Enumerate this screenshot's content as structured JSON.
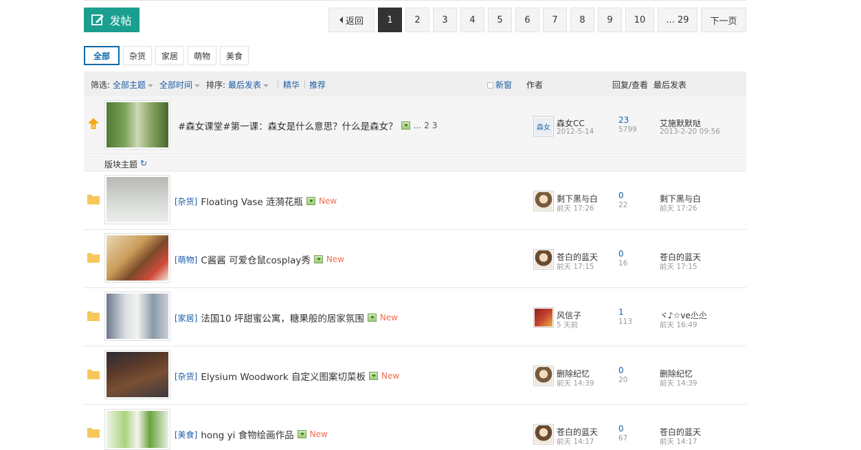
{
  "toolbar": {
    "post_label": "发帖"
  },
  "pagination": {
    "back_label": "返回",
    "pages": [
      "1",
      "2",
      "3",
      "4",
      "5",
      "6",
      "7",
      "8",
      "9",
      "10"
    ],
    "last_label": "... 29",
    "next_label": "下一页",
    "current": "1"
  },
  "category_tabs": [
    "全部",
    "杂货",
    "家居",
    "萌物",
    "美食"
  ],
  "filter": {
    "filter_label": "筛选:",
    "all_topics": "全部主题",
    "all_time": "全部时间",
    "sort_label": "排序:",
    "last_post": "最后发表",
    "digest": "精华",
    "recommend": "推荐",
    "new_window": "新窗",
    "col_author": "作者",
    "col_reply_view": "回复/查看",
    "col_last_post": "最后发表"
  },
  "sticky": {
    "title": "#森女课堂#第一课：森女是什么意思？什么是森女？",
    "pages_prefix": "...",
    "pages": [
      "2",
      "3"
    ],
    "author": "森女CC",
    "author_date": "2012-5-14",
    "replies": "23",
    "views": "5799",
    "last_user": "艾施默默哒",
    "last_date": "2013-2-20 09:56"
  },
  "section": {
    "title": "版块主题"
  },
  "new_label": "New",
  "threads": [
    {
      "category": "[杂货]",
      "title": "Floating Vase 涟漪花瓶",
      "author": "剩下黑与白",
      "author_date": "前天 17:26",
      "replies": "0",
      "views": "22",
      "last_user": "剩下黑与白",
      "last_date": "前天 17:26"
    },
    {
      "category": "[萌物]",
      "title": "C酱酱 可爱仓鼠cosplay秀",
      "author": "苍白的蓝天",
      "author_date": "前天 17:15",
      "replies": "0",
      "views": "16",
      "last_user": "苍白的蓝天",
      "last_date": "前天 17:15"
    },
    {
      "category": "[家居]",
      "title": "法国10 坪甜蜜公寓，糖果般的居家氛围",
      "author": "风信子",
      "author_date": "5 天前",
      "replies": "1",
      "views": "113",
      "last_user": "ヾ♪☆ve尐尐",
      "last_date": "前天 16:49"
    },
    {
      "category": "[杂货]",
      "title": "Elysium Woodwork 自定义图案切菜板",
      "author": "删除纪忆",
      "author_date": "前天 14:39",
      "replies": "0",
      "views": "20",
      "last_user": "删除纪忆",
      "last_date": "前天 14:39"
    },
    {
      "category": "[美食]",
      "title": "hong yi 食物绘画作品",
      "author": "苍白的蓝天",
      "author_date": "前天 14:17",
      "replies": "0",
      "views": "67",
      "last_user": "苍白的蓝天",
      "last_date": "前天 14:17"
    }
  ],
  "colors": {
    "accent": "#1a9e8f",
    "link": "#1b5da6",
    "new": "#f26c4f"
  }
}
